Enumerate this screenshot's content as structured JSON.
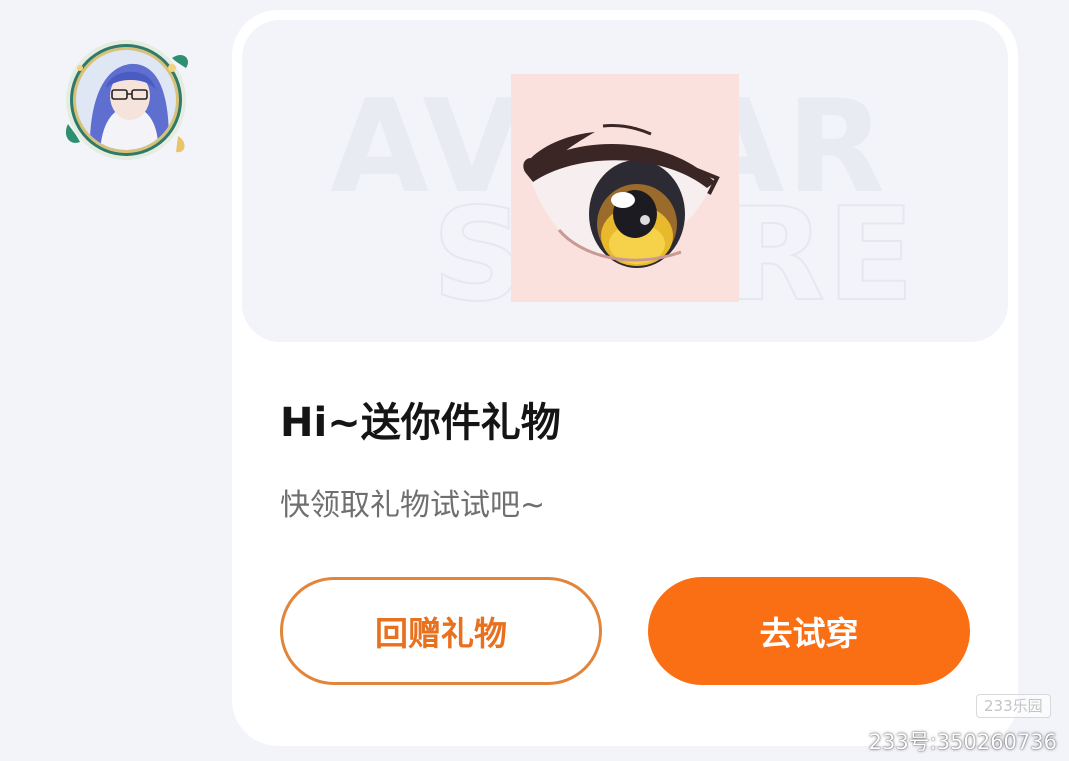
{
  "banner": {
    "watermark_line1": "AVATAR",
    "watermark_line2": "STORE"
  },
  "gift": {
    "title": "Hi~送你件礼物",
    "subtitle": "快领取礼物试试吧~",
    "item_icon": "anime-eye-icon"
  },
  "actions": {
    "return_gift_label": "回赠礼物",
    "try_on_label": "去试穿"
  },
  "corner": {
    "logo_text": "233乐园",
    "user_id_text": "233号:350260736"
  },
  "colors": {
    "accent": "#fb6f14",
    "accent_border": "#e2853a",
    "page_background": "#f3f4fa",
    "title_text": "#151515",
    "subtitle_text": "#6f6f6f"
  }
}
